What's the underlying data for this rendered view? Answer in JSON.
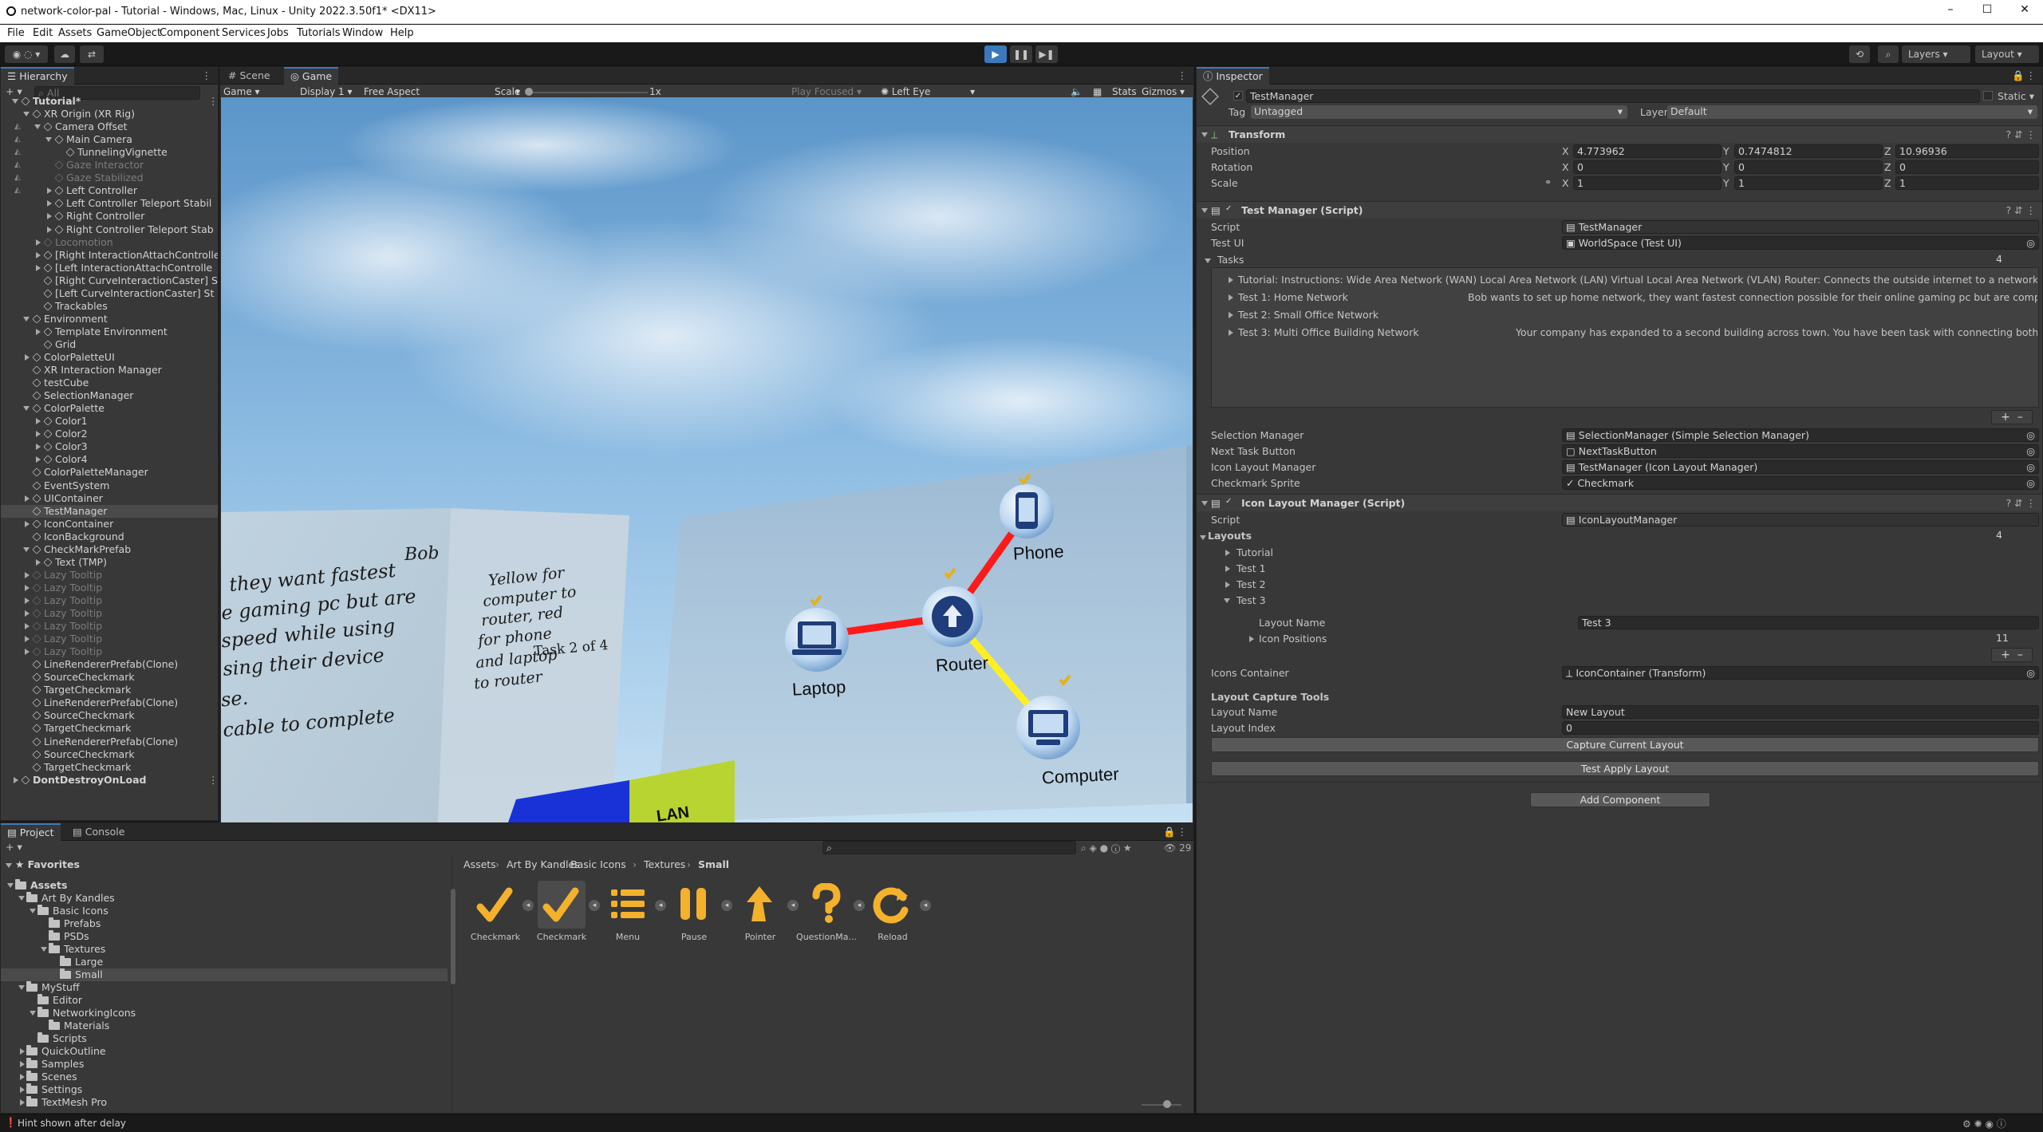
{
  "window": {
    "title": "network-color-pal - Tutorial - Windows, Mac, Linux - Unity 2022.3.50f1* <DX11>",
    "minimize": "–",
    "maximize": "☐",
    "close": "✕"
  },
  "menu": [
    "File",
    "Edit",
    "Assets",
    "GameObject",
    "Component",
    "Services",
    "Jobs",
    "Tutorials",
    "Window",
    "Help"
  ],
  "toolbar": {
    "layers": "Layers",
    "layout": "Layout"
  },
  "hierarchy": {
    "tab": "Hierarchy",
    "search_placeholder": "All",
    "items": [
      {
        "label": "Tutorial*",
        "depth": 0,
        "expand": "open",
        "dim": false,
        "scene": true
      },
      {
        "label": "XR Origin (XR Rig)",
        "depth": 1,
        "expand": "open",
        "dim": false
      },
      {
        "label": "Camera Offset",
        "depth": 2,
        "expand": "open",
        "dim": false
      },
      {
        "label": "Main Camera",
        "depth": 3,
        "expand": "open",
        "dim": false
      },
      {
        "label": "TunnelingVignette",
        "depth": 4,
        "expand": "none",
        "dim": false
      },
      {
        "label": "Gaze Interactor",
        "depth": 3,
        "expand": "none",
        "dim": true
      },
      {
        "label": "Gaze Stabilized",
        "depth": 3,
        "expand": "none",
        "dim": true
      },
      {
        "label": "Left Controller",
        "depth": 3,
        "expand": "closed",
        "dim": false
      },
      {
        "label": "Left Controller Teleport Stabil",
        "depth": 3,
        "expand": "closed",
        "dim": false
      },
      {
        "label": "Right Controller",
        "depth": 3,
        "expand": "closed",
        "dim": false
      },
      {
        "label": "Right Controller Teleport Stab",
        "depth": 3,
        "expand": "closed",
        "dim": false
      },
      {
        "label": "Locomotion",
        "depth": 2,
        "expand": "closed",
        "dim": true
      },
      {
        "label": "[Right InteractionAttachControlle",
        "depth": 2,
        "expand": "closed",
        "dim": false
      },
      {
        "label": "[Left InteractionAttachControlle",
        "depth": 2,
        "expand": "closed",
        "dim": false
      },
      {
        "label": "[Right CurveInteractionCaster] S",
        "depth": 2,
        "expand": "none",
        "dim": false
      },
      {
        "label": "[Left CurveInteractionCaster] St",
        "depth": 2,
        "expand": "none",
        "dim": false
      },
      {
        "label": "Trackables",
        "depth": 2,
        "expand": "none",
        "dim": false
      },
      {
        "label": "Environment",
        "depth": 1,
        "expand": "open",
        "dim": false
      },
      {
        "label": "Template Environment",
        "depth": 2,
        "expand": "closed",
        "dim": false
      },
      {
        "label": "Grid",
        "depth": 2,
        "expand": "none",
        "dim": false
      },
      {
        "label": "ColorPaletteUI",
        "depth": 1,
        "expand": "closed",
        "dim": false
      },
      {
        "label": "XR Interaction Manager",
        "depth": 1,
        "expand": "none",
        "dim": false
      },
      {
        "label": "testCube",
        "depth": 1,
        "expand": "none",
        "dim": false
      },
      {
        "label": "SelectionManager",
        "depth": 1,
        "expand": "none",
        "dim": false
      },
      {
        "label": "ColorPalette",
        "depth": 1,
        "expand": "open",
        "dim": false
      },
      {
        "label": "Color1",
        "depth": 2,
        "expand": "closed",
        "dim": false
      },
      {
        "label": "Color2",
        "depth": 2,
        "expand": "closed",
        "dim": false
      },
      {
        "label": "Color3",
        "depth": 2,
        "expand": "closed",
        "dim": false
      },
      {
        "label": "Color4",
        "depth": 2,
        "expand": "closed",
        "dim": false
      },
      {
        "label": "ColorPaletteManager",
        "depth": 1,
        "expand": "none",
        "dim": false
      },
      {
        "label": "EventSystem",
        "depth": 1,
        "expand": "none",
        "dim": false
      },
      {
        "label": "UIContainer",
        "depth": 1,
        "expand": "closed",
        "dim": false
      },
      {
        "label": "TestManager",
        "depth": 1,
        "expand": "none",
        "dim": false,
        "selected": true
      },
      {
        "label": "IconContainer",
        "depth": 1,
        "expand": "closed",
        "dim": false
      },
      {
        "label": "IconBackground",
        "depth": 1,
        "expand": "none",
        "dim": false
      },
      {
        "label": "CheckMarkPrefab",
        "depth": 1,
        "expand": "open",
        "dim": false
      },
      {
        "label": "Text (TMP)",
        "depth": 2,
        "expand": "closed",
        "dim": false
      },
      {
        "label": "Lazy Tooltip",
        "depth": 1,
        "expand": "closed",
        "dim": true
      },
      {
        "label": "Lazy Tooltip",
        "depth": 1,
        "expand": "closed",
        "dim": true
      },
      {
        "label": "Lazy Tooltip",
        "depth": 1,
        "expand": "closed",
        "dim": true
      },
      {
        "label": "Lazy Tooltip",
        "depth": 1,
        "expand": "closed",
        "dim": true
      },
      {
        "label": "Lazy Tooltip",
        "depth": 1,
        "expand": "closed",
        "dim": true
      },
      {
        "label": "Lazy Tooltip",
        "depth": 1,
        "expand": "closed",
        "dim": true
      },
      {
        "label": "Lazy Tooltip",
        "depth": 1,
        "expand": "closed",
        "dim": true
      },
      {
        "label": "LineRendererPrefab(Clone)",
        "depth": 1,
        "expand": "none",
        "dim": false
      },
      {
        "label": "SourceCheckmark",
        "depth": 1,
        "expand": "none",
        "dim": false
      },
      {
        "label": "TargetCheckmark",
        "depth": 1,
        "expand": "none",
        "dim": false
      },
      {
        "label": "LineRendererPrefab(Clone)",
        "depth": 1,
        "expand": "none",
        "dim": false
      },
      {
        "label": "SourceCheckmark",
        "depth": 1,
        "expand": "none",
        "dim": false
      },
      {
        "label": "TargetCheckmark",
        "depth": 1,
        "expand": "none",
        "dim": false
      },
      {
        "label": "LineRendererPrefab(Clone)",
        "depth": 1,
        "expand": "none",
        "dim": false
      },
      {
        "label": "SourceCheckmark",
        "depth": 1,
        "expand": "none",
        "dim": false
      },
      {
        "label": "TargetCheckmark",
        "depth": 1,
        "expand": "none",
        "dim": false
      },
      {
        "label": "DontDestroyOnLoad",
        "depth": 0,
        "expand": "closed",
        "dim": false,
        "scene": true
      }
    ]
  },
  "scene_view": {
    "tabs": [
      "Scene",
      "Game"
    ],
    "game_dropdown": "Game",
    "display": "Display 1",
    "aspect": "Free Aspect",
    "scale_label": "Scale",
    "scale_value": "1x",
    "play_focused": "Play Focused",
    "eye": "Left Eye",
    "stats": "Stats",
    "gizmos": "Gizmos"
  },
  "viewport": {
    "panel1_lines": [
      "Bob",
      "they want fastest",
      "e gaming pc but are",
      "speed while using",
      "sing their device",
      "se.",
      "cable to complete"
    ],
    "panel2_lines": [
      "Yellow for",
      "computer to",
      "router, red",
      "for phone",
      "and laptop",
      "to router"
    ],
    "task_counter": "Task 2 of 4",
    "nodes": {
      "phone": "Phone",
      "router": "Router",
      "laptop": "Laptop",
      "computer": "Computer"
    },
    "block_label": "LAN"
  },
  "inspector": {
    "tab": "Inspector",
    "object_name": "TestManager",
    "static_label": "Static",
    "tag_label": "Tag",
    "tag_value": "Untagged",
    "layer_label": "Layer",
    "layer_value": "Default",
    "transform": {
      "title": "Transform",
      "position": {
        "label": "Position",
        "x": "4.773962",
        "y": "0.7474812",
        "z": "10.96936"
      },
      "rotation": {
        "label": "Rotation",
        "x": "0",
        "y": "0",
        "z": "0"
      },
      "scale": {
        "label": "Scale",
        "x": "1",
        "y": "1",
        "z": "1"
      },
      "axis": {
        "x": "X",
        "y": "Y",
        "z": "Z"
      }
    },
    "test_manager": {
      "title": "Test Manager (Script)",
      "script_label": "Script",
      "script_value": "TestManager",
      "test_ui_label": "Test UI",
      "test_ui_value": "WorldSpace (Test UI)",
      "tasks_label": "Tasks",
      "tasks_count": "4",
      "tasks": [
        {
          "name": "Tutorial: Instructions: Wide Area Network (WAN) Local Area Network (LAN) Virtual Local Area Network (VLAN)  Router: Connects the outside internet to a network Switch: Route",
          "desc": ""
        },
        {
          "name": "Test 1: Home Network",
          "desc": "Bob wants to set up home network, they want fastest connection possible for their online gaming pc but are completely fine v"
        },
        {
          "name": "Test 2: Small Office Network",
          "desc": ""
        },
        {
          "name": "Test 3: Multi Office Building Network",
          "desc": "Your company has expanded to a second building across town. You have been task with connecting both office networ"
        }
      ],
      "add": "+",
      "remove": "–",
      "selection_manager_label": "Selection Manager",
      "selection_manager_value": "SelectionManager (Simple Selection Manager)",
      "next_task_label": "Next Task Button",
      "next_task_value": "NextTaskButton",
      "icon_layout_label": "Icon Layout Manager",
      "icon_layout_value": "TestManager (Icon Layout Manager)",
      "checkmark_label": "Checkmark Sprite",
      "checkmark_value": "Checkmark"
    },
    "icon_layout": {
      "title": "Icon Layout Manager (Script)",
      "script_label": "Script",
      "script_value": "IconLayoutManager",
      "layouts_label": "Layouts",
      "layouts_count": "4",
      "layouts": [
        "Tutorial",
        "Test 1",
        "Test 2",
        "Test 3"
      ],
      "layout_name_label": "Layout Name",
      "layout_name_value": "Test 3",
      "icon_positions_label": "Icon Positions",
      "icon_positions_count": "11",
      "icons_container_label": "Icons Container",
      "icons_container_value": "IconContainer (Transform)",
      "capture_header": "Layout Capture Tools",
      "capture_name_label": "Layout Name",
      "capture_name_value": "New Layout",
      "capture_index_label": "Layout Index",
      "capture_index_value": "0",
      "capture_button": "Capture Current Layout",
      "apply_button": "Test Apply Layout"
    },
    "add_component": "Add Component"
  },
  "project": {
    "tabs": [
      "Project",
      "Console"
    ],
    "favorites": "Favorites",
    "asset_count": "29",
    "tree": [
      {
        "label": "Assets",
        "depth": 0,
        "expand": "open",
        "bold": true
      },
      {
        "label": "Art By Kandles",
        "depth": 1,
        "expand": "open"
      },
      {
        "label": "Basic Icons",
        "depth": 2,
        "expand": "open"
      },
      {
        "label": "Prefabs",
        "depth": 3,
        "expand": "none"
      },
      {
        "label": "PSDs",
        "depth": 3,
        "expand": "none"
      },
      {
        "label": "Textures",
        "depth": 3,
        "expand": "open"
      },
      {
        "label": "Large",
        "depth": 4,
        "expand": "none"
      },
      {
        "label": "Small",
        "depth": 4,
        "expand": "none",
        "selected": true
      },
      {
        "label": "MyStuff",
        "depth": 1,
        "expand": "open"
      },
      {
        "label": "Editor",
        "depth": 2,
        "expand": "none"
      },
      {
        "label": "NetworkingIcons",
        "depth": 2,
        "expand": "open"
      },
      {
        "label": "Materials",
        "depth": 3,
        "expand": "none"
      },
      {
        "label": "Scripts",
        "depth": 2,
        "expand": "none"
      },
      {
        "label": "QuickOutline",
        "depth": 1,
        "expand": "closed"
      },
      {
        "label": "Samples",
        "depth": 1,
        "expand": "closed"
      },
      {
        "label": "Scenes",
        "depth": 1,
        "expand": "closed"
      },
      {
        "label": "Settings",
        "depth": 1,
        "expand": "closed"
      },
      {
        "label": "TextMesh Pro",
        "depth": 1,
        "expand": "closed"
      }
    ],
    "breadcrumb": [
      "Assets",
      "Art By Kandles",
      "Basic Icons",
      "Textures",
      "Small"
    ],
    "assets": [
      {
        "label": "Checkmark",
        "icon": "checkmark-icon"
      },
      {
        "label": "Checkmark",
        "icon": "checkmark-icon",
        "selected": true
      },
      {
        "label": "Menu",
        "icon": "menu-icon"
      },
      {
        "label": "Pause",
        "icon": "pause-icon"
      },
      {
        "label": "Pointer",
        "icon": "pointer-icon"
      },
      {
        "label": "QuestionMa...",
        "icon": "question-icon"
      },
      {
        "label": "Reload",
        "icon": "reload-icon"
      }
    ]
  },
  "status": {
    "hint": "Hint shown after delay"
  },
  "colors": {
    "accent": "#3a79bb",
    "selection": "#2c5d87",
    "red_link": "#ff1a1a",
    "yellow_link": "#ffee22",
    "node_blue": "#1e3d7a"
  }
}
